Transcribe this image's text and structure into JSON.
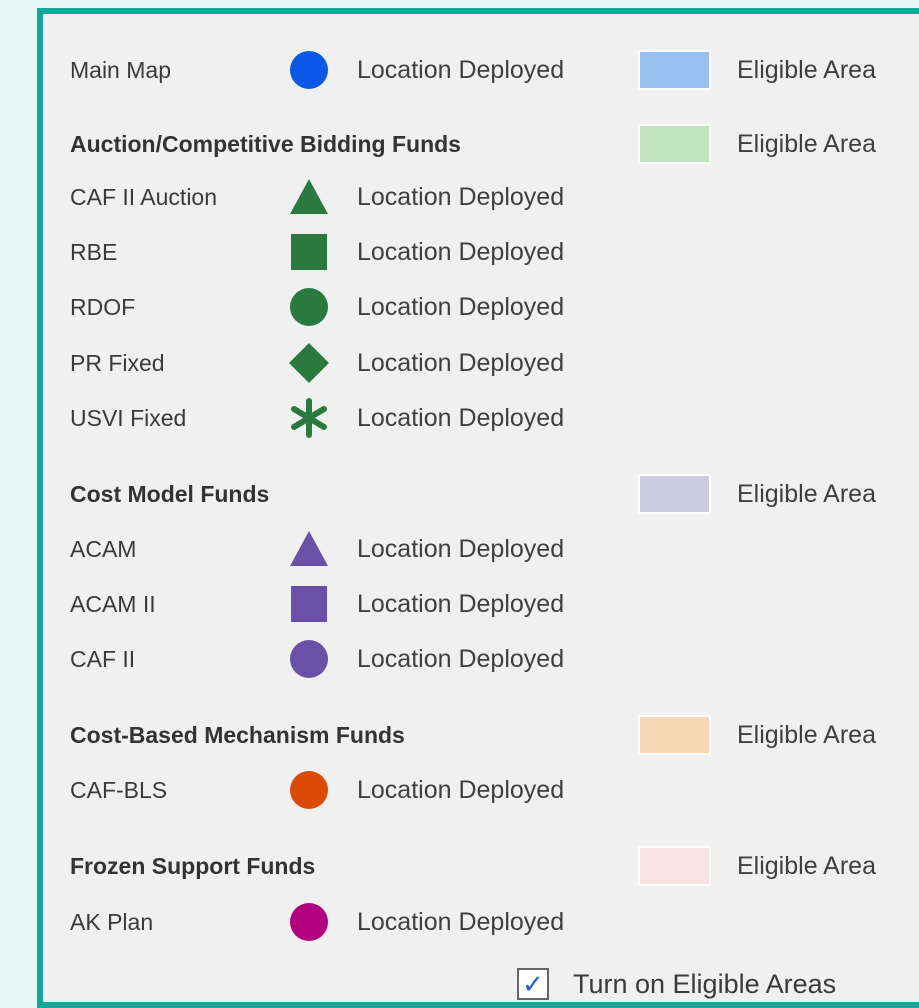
{
  "legend": {
    "location_deployed": "Location Deployed",
    "eligible_area": "Eligible Area",
    "main_map": {
      "label": "Main Map",
      "symbol_color": "#0a57e8",
      "swatch_color": "#99c0f1"
    },
    "auction": {
      "heading": "Auction/Competitive Bidding Funds",
      "swatch_color": "#bfe4bd",
      "symbol_color": "#2a7a40",
      "items": [
        {
          "label": "CAF II Auction",
          "icon": "triangle-icon"
        },
        {
          "label": "RBE",
          "icon": "square-icon"
        },
        {
          "label": "RDOF",
          "icon": "circle-icon"
        },
        {
          "label": "PR Fixed",
          "icon": "diamond-icon"
        },
        {
          "label": "USVI Fixed",
          "icon": "asterisk-icon"
        }
      ]
    },
    "cost_model": {
      "heading": "Cost Model Funds",
      "swatch_color": "#cdcbe2",
      "symbol_color": "#6a50a7",
      "items": [
        {
          "label": "ACAM",
          "icon": "triangle-icon"
        },
        {
          "label": "ACAM II",
          "icon": "square-icon"
        },
        {
          "label": "CAF II",
          "icon": "circle-icon"
        }
      ]
    },
    "cost_based": {
      "heading": "Cost-Based Mechanism Funds",
      "swatch_color": "#f6d6b5",
      "symbol_color": "#dc4a0a",
      "items": [
        {
          "label": "CAF-BLS",
          "icon": "circle-icon"
        }
      ]
    },
    "frozen": {
      "heading": "Frozen Support Funds",
      "swatch_color": "#f9e2e4",
      "symbol_color": "#b3007f",
      "items": [
        {
          "label": "AK Plan",
          "icon": "circle-icon"
        }
      ]
    }
  },
  "toggle": {
    "label": "Turn on Eligible Areas",
    "checked": true,
    "check_glyph": "✓"
  }
}
